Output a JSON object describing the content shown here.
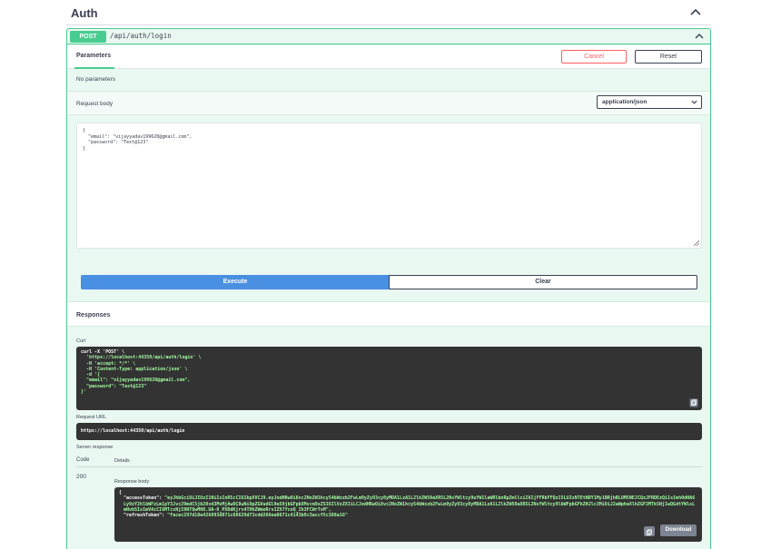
{
  "section": {
    "title": "Auth"
  },
  "operation": {
    "method": "POST",
    "path": "/api/auth/login"
  },
  "tabs": {
    "parameters": "Parameters"
  },
  "buttons": {
    "cancel": "Cancel",
    "reset": "Reset",
    "execute": "Execute",
    "clear": "Clear",
    "download": "Download"
  },
  "parameters": {
    "empty_text": "No parameters"
  },
  "request_body": {
    "label": "Request body",
    "content_type": "application/json",
    "lines": [
      "{",
      "  \"email\": \"vijayyadav199620@gmail.com\",",
      "  \"password\": \"Test@123\"",
      "}"
    ]
  },
  "responses": {
    "title": "Responses",
    "curl_label": "Curl",
    "curl_lines": [
      "curl -X 'POST' \\",
      "  'https://localhost:44350/api/auth/login' \\",
      "  -H 'accept: */*' \\",
      "  -H 'Content-Type: application/json' \\",
      "  -d '{",
      "  \"email\": \"vijayyadav199620@gmail.com\",",
      "  \"password\": \"Test@123\"",
      "}'"
    ],
    "request_url_label": "Request URL",
    "request_url": "https://localhost:44350/api/auth/login",
    "server_response_label": "Server response",
    "code_header": "Code",
    "details_header": "Details",
    "code": "200",
    "response_body_label": "Response body",
    "body": {
      "open": "{",
      "access_key": "\"accessToken\":",
      "access_value": "\"eyJhbGciOiJIUzI1NiIsInR5cCI6IkpXVCJ9.eyJodHRwOi8vc2NoZW1hcy54bWxzb2FwLm9yZy93cy8yMDA1LzA1L2lkZW50aXR5L2NsYWltcy9uYW1laWRlbnRpZmllciI6IjFFRkFFQzI5LUIxNTEtNDY1My1BRjhBLUM5NEJCQzJFRDEzQiIsImh0dHA6Ly9zY2hlbWFzLm1pY3Jvc29mdC5jb20vd3MvMjAwOC8wNi9pZGVudGl0eS9jbGFpbXMvcm9sZSI6IlVzZXIiLCJodHRwOi8vc2NoZW1hcy54bWxzb2FwLm9yZy93cy8yMDA1LzA1L2lkZW50aXR5L2NsYWltcy9lbWFpbGFkZHJlc3MiOiJ2aWpheXlhZGF2MTk5NjIwQGdtYWlsLmNvbSIsImV4cCI6MTcxNjI0NTQwMH0.UA-8_PXDdKjrv4THhZWmoRrsIZX7fcoQ_Ih3FCWrTsM\",",
      "refresh_key": "\"refreshToken\":",
      "refresh_value": "\"facec297d18e426893d871c68629d73cdd266ea0671c4143b9c3accf5c388a16\""
    }
  }
}
